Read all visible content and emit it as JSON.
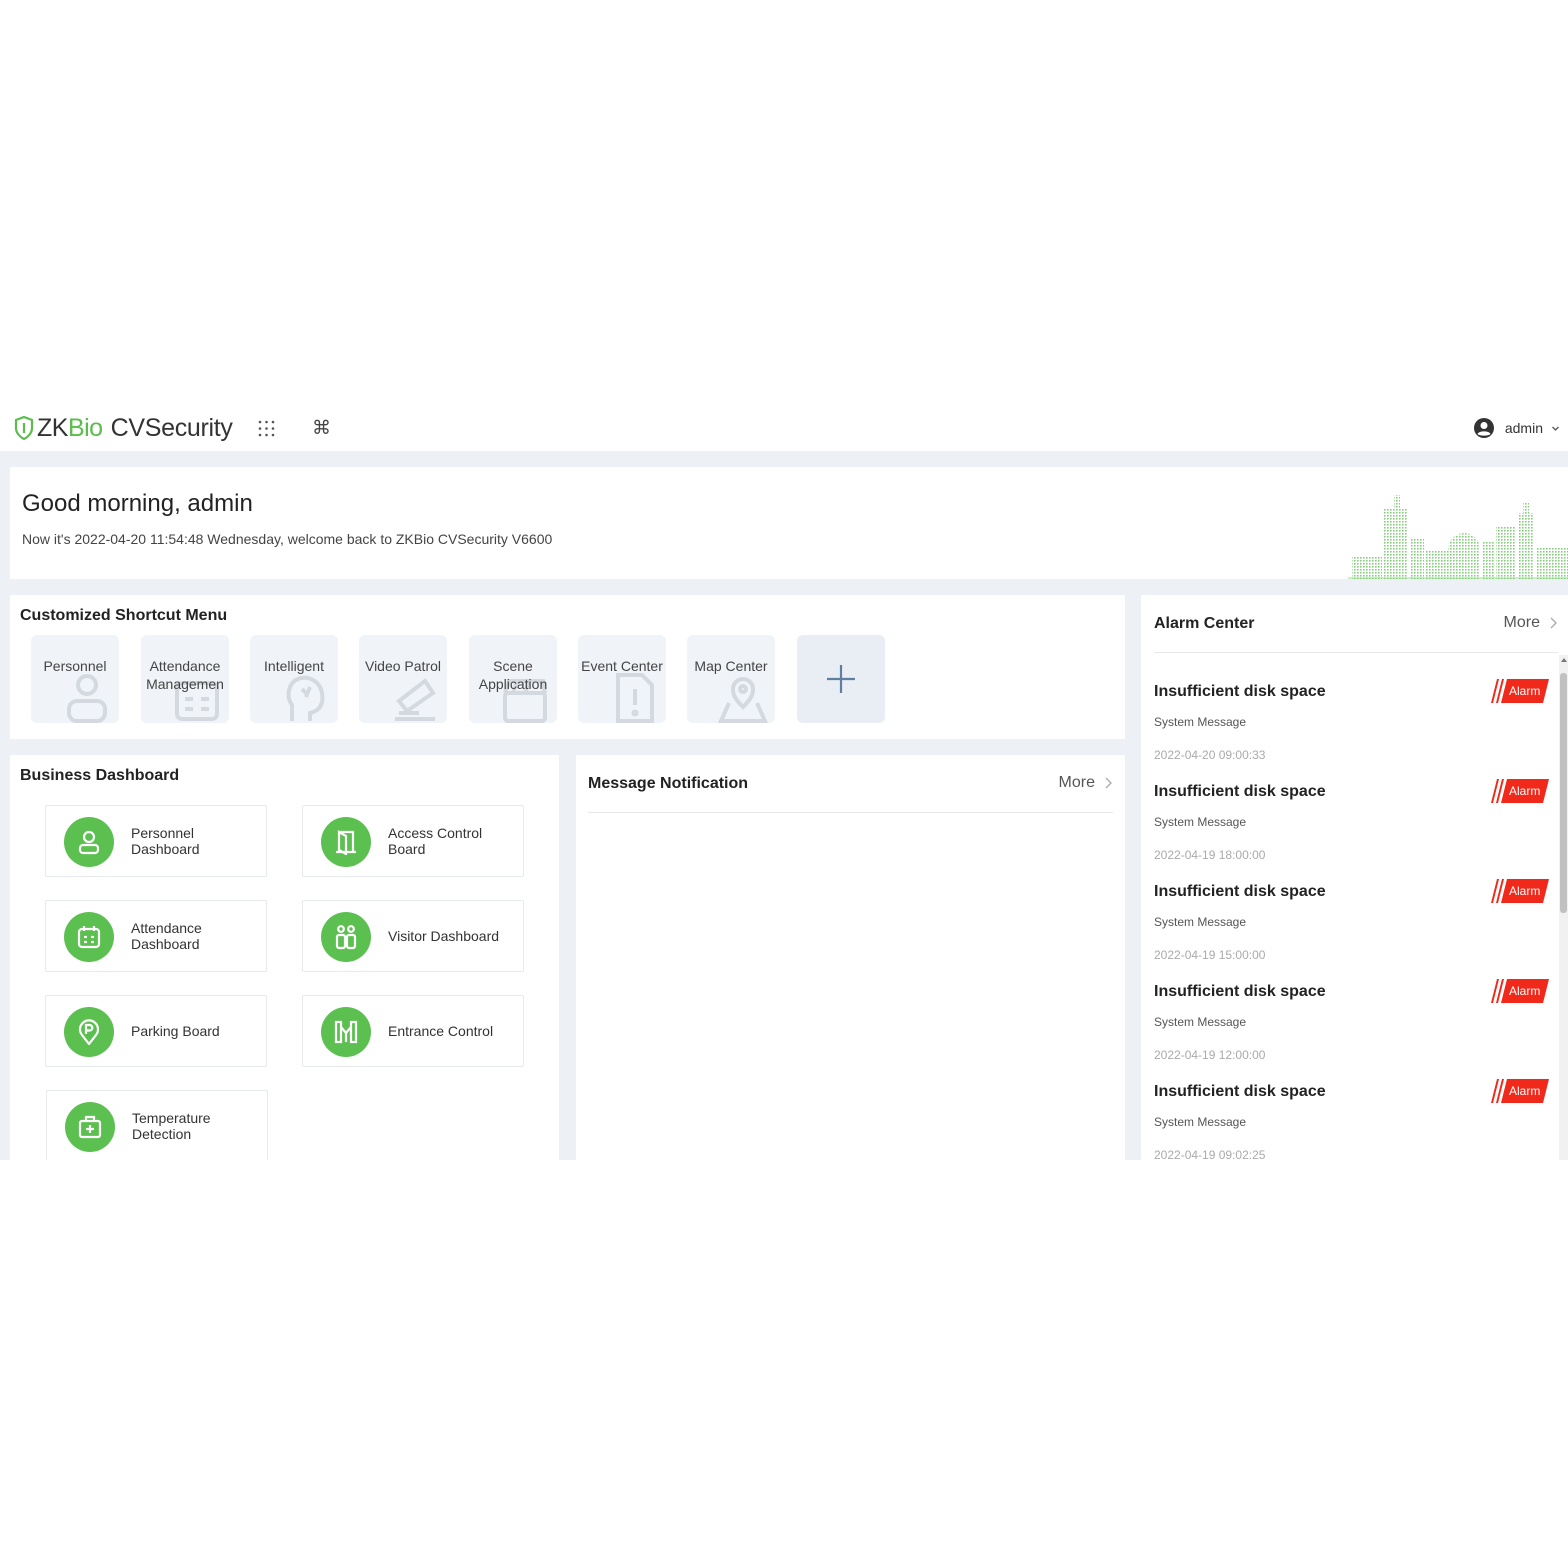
{
  "header": {
    "logo": {
      "zk": "ZK",
      "bio": "Bio",
      "product": "CVSecurity"
    },
    "cmd_glyph": "⌘",
    "user_name": "admin"
  },
  "welcome": {
    "greeting": "Good morning, admin",
    "subtitle": "Now it's 2022-04-20 11:54:48 Wednesday, welcome back to ZKBio CVSecurity V6600"
  },
  "shortcut": {
    "title": "Customized Shortcut Menu",
    "items": [
      {
        "label": "Personnel",
        "icon": "person-icon"
      },
      {
        "label": "Attendance Managemen",
        "icon": "calendar-icon"
      },
      {
        "label": "Intelligent",
        "icon": "brain-head-icon"
      },
      {
        "label": "Video Patrol",
        "icon": "camera-icon"
      },
      {
        "label": "Scene Application",
        "icon": "clapperboard-icon"
      },
      {
        "label": "Event Center",
        "icon": "alert-file-icon"
      },
      {
        "label": "Map Center",
        "icon": "map-pin-icon"
      }
    ]
  },
  "business": {
    "title": "Business Dashboard",
    "items": [
      {
        "label": "Personnel Dashboard",
        "icon": "person-icon"
      },
      {
        "label": "Access Control Board",
        "icon": "door-icon"
      },
      {
        "label": "Attendance Dashboard",
        "icon": "calendar-icon"
      },
      {
        "label": "Visitor Dashboard",
        "icon": "visitors-icon"
      },
      {
        "label": "Parking Board",
        "icon": "parking-icon"
      },
      {
        "label": "Entrance Control",
        "icon": "turnstile-icon"
      },
      {
        "label": "Temperature Detection",
        "icon": "medical-kit-icon"
      }
    ]
  },
  "message": {
    "title": "Message Notification",
    "more": "More"
  },
  "alarm": {
    "title": "Alarm Center",
    "more": "More",
    "items": [
      {
        "title": "Insufficient disk space",
        "source": "System Message",
        "time": "2022-04-20 09:00:33",
        "badge": "Alarm"
      },
      {
        "title": "Insufficient disk space",
        "source": "System Message",
        "time": "2022-04-19 18:00:00",
        "badge": "Alarm"
      },
      {
        "title": "Insufficient disk space",
        "source": "System Message",
        "time": "2022-04-19 15:00:00",
        "badge": "Alarm"
      },
      {
        "title": "Insufficient disk space",
        "source": "System Message",
        "time": "2022-04-19 12:00:00",
        "badge": "Alarm"
      },
      {
        "title": "Insufficient disk space",
        "source": "System Message",
        "time": "2022-04-19 09:02:25",
        "badge": "Alarm"
      }
    ]
  },
  "colors": {
    "brand_green": "#5cc051",
    "alarm_red": "#f0291a",
    "tile_bg": "#f0f3f7",
    "page_bg": "#edf1f6"
  }
}
